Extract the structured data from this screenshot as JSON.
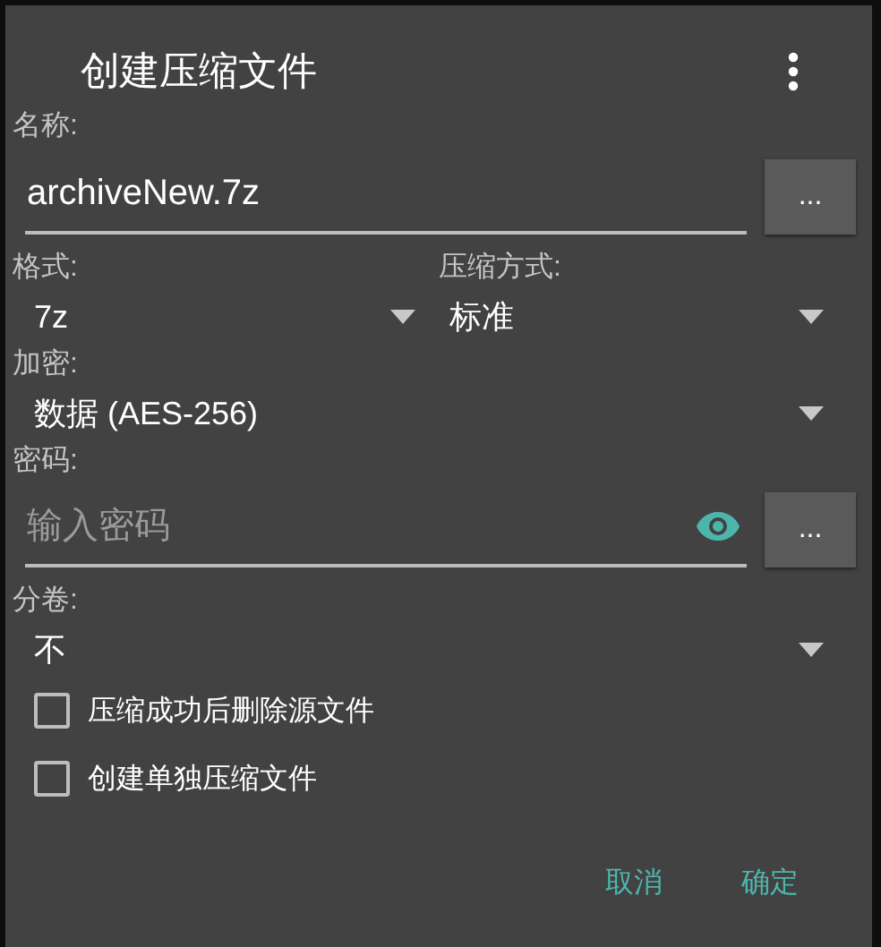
{
  "dialog": {
    "title": "创建压缩文件",
    "name": {
      "label": "名称:",
      "value": "archiveNew.7z",
      "button": "..."
    },
    "format": {
      "label": "格式:",
      "value": "7z"
    },
    "compression": {
      "label": "压缩方式:",
      "value": "标准"
    },
    "encryption": {
      "label": "加密:",
      "value": "数据 (AES-256)"
    },
    "password": {
      "label": "密码:",
      "placeholder": "输入密码",
      "button": "..."
    },
    "split": {
      "label": "分卷:",
      "value": "不"
    },
    "options": [
      {
        "label": "压缩成功后删除源文件",
        "checked": false
      },
      {
        "label": "创建单独压缩文件",
        "checked": false
      }
    ],
    "buttons": [
      "取消",
      "确定"
    ]
  }
}
